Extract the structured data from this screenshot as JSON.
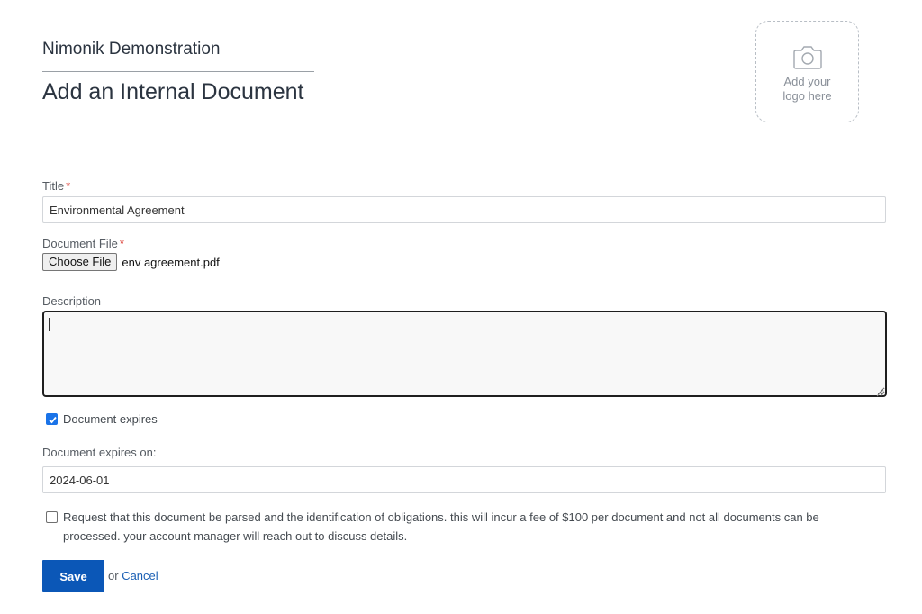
{
  "header": {
    "org_name": "Nimonik Demonstration",
    "page_title": "Add an Internal Document",
    "logo_placeholder": "Add your\nlogo here"
  },
  "form": {
    "title": {
      "label": "Title",
      "required_mark": "*",
      "value": "Environmental Agreement"
    },
    "document_file": {
      "label": "Document File",
      "required_mark": "*",
      "button_label": "Choose File",
      "file_name": "env agreement.pdf"
    },
    "description": {
      "label": "Description",
      "value": ""
    },
    "expires_checkbox": {
      "label": "Document expires",
      "checked": true
    },
    "expires_on": {
      "label": "Document expires on:",
      "value": "2024-06-01"
    },
    "parse_request": {
      "label": "Request that this document be parsed and the identification of obligations. this will incur a fee of $100 per document and not all documents can be processed. your account manager will reach out to discuss details.",
      "checked": false
    }
  },
  "actions": {
    "save_label": "Save",
    "or_text": "or",
    "cancel_label": "Cancel"
  },
  "colors": {
    "primary": "#0b57b7",
    "link": "#1a5fb4",
    "required": "#d9342b",
    "checkbox": "#1a73e8"
  },
  "icons": {
    "logo": "camera-icon",
    "checkbox": "checkmark-icon",
    "textarea": "resize-grip-icon"
  }
}
